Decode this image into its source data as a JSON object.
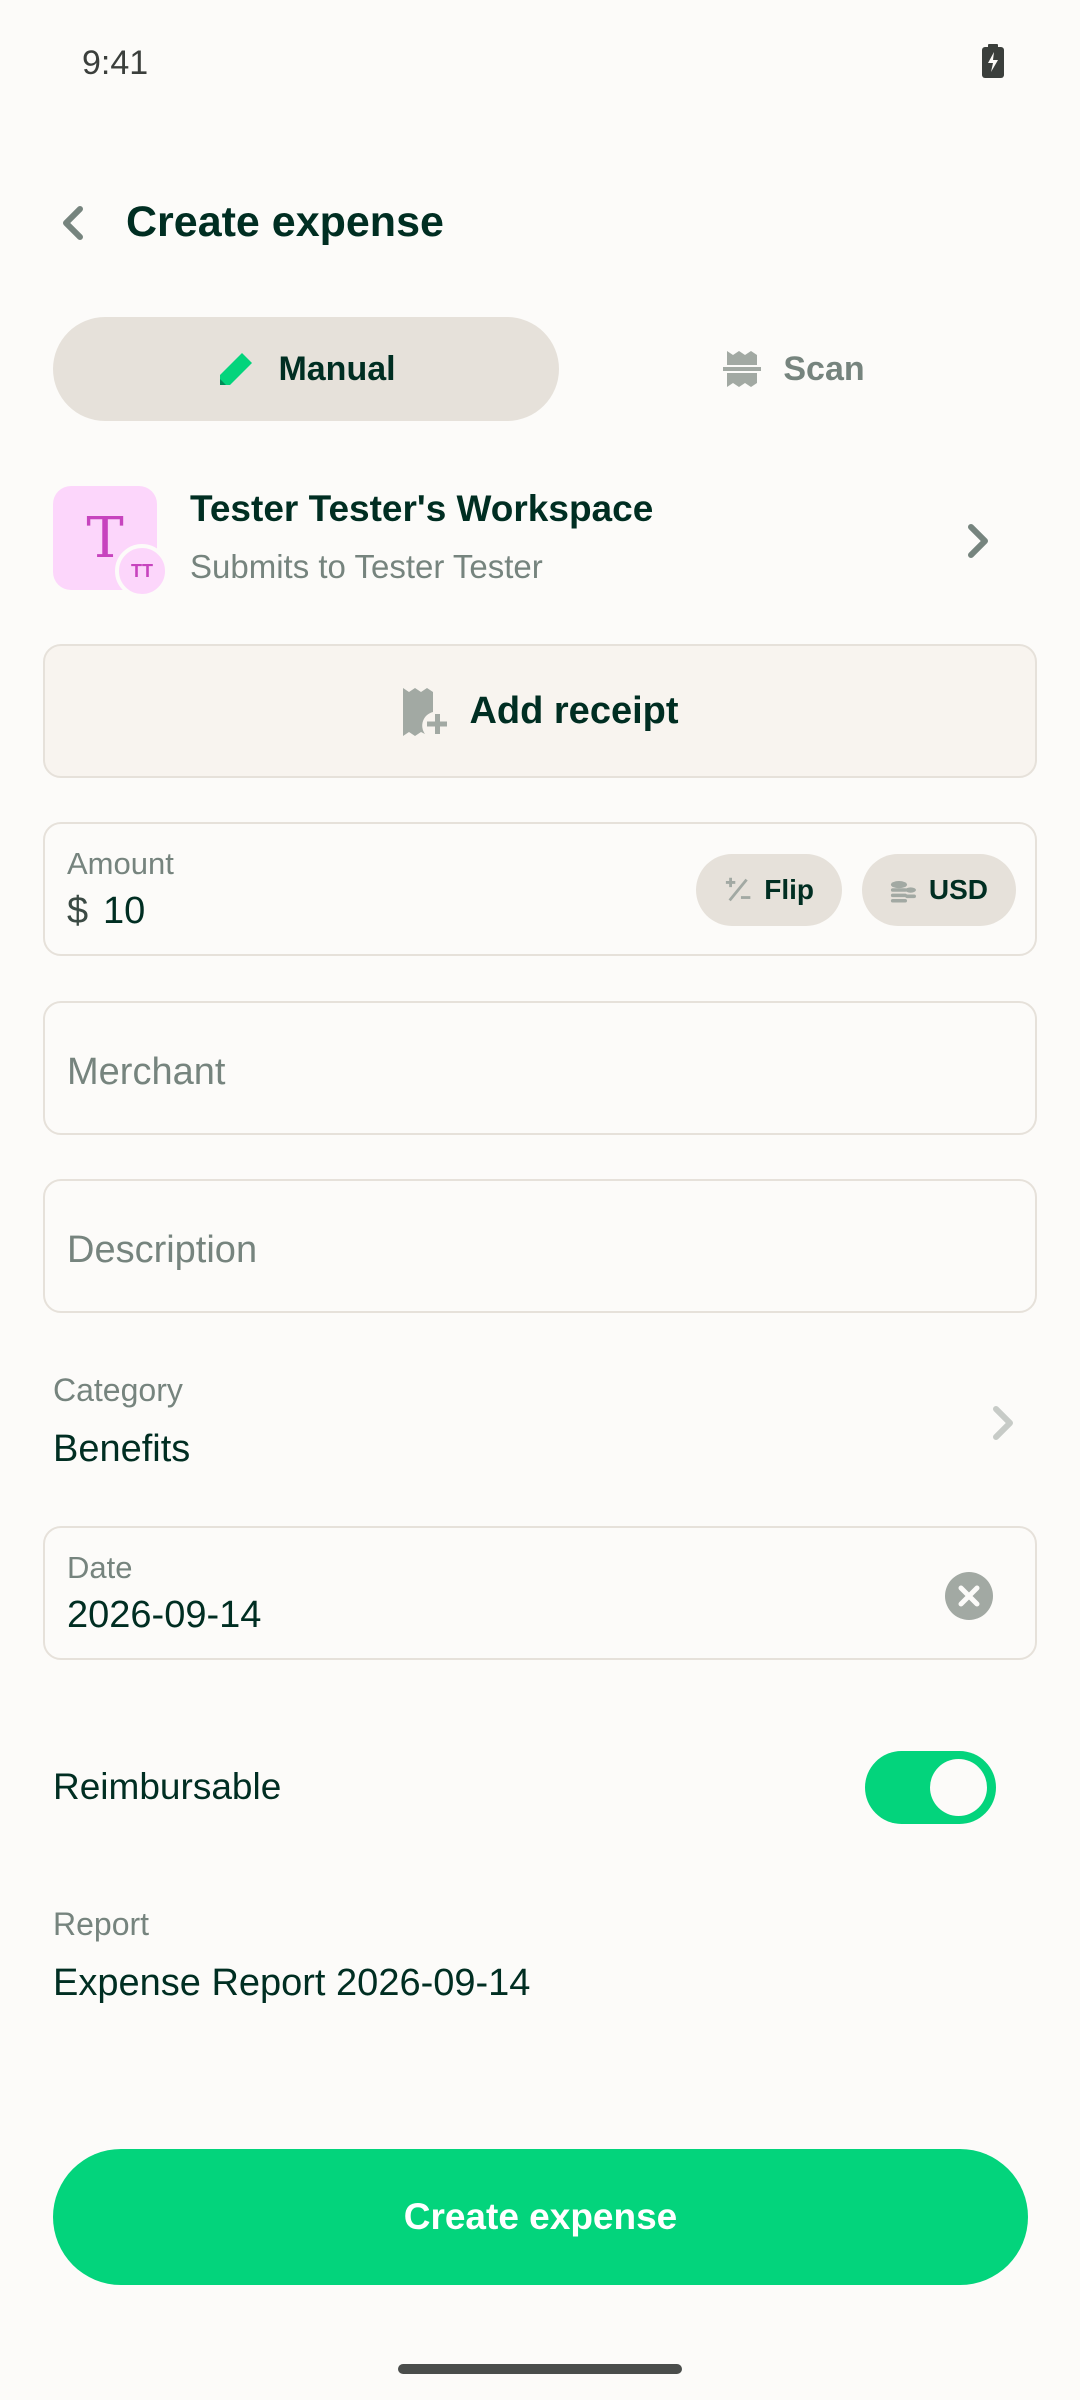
{
  "status_bar": {
    "time": "9:41",
    "battery_icon": "battery-charging-icon"
  },
  "header": {
    "title": "Create expense",
    "back_icon": "chevron-left-icon"
  },
  "tabs": [
    {
      "label": "Manual",
      "icon": "pencil-icon",
      "selected": true
    },
    {
      "label": "Scan",
      "icon": "receipt-scan-icon",
      "selected": false
    }
  ],
  "workspace": {
    "avatar_letter": "T",
    "sub_avatar_initials": "TT",
    "name": "Tester Tester's Workspace",
    "subtitle": "Submits to Tester Tester"
  },
  "add_receipt": {
    "label": "Add receipt",
    "icon": "receipt-plus-icon"
  },
  "amount": {
    "label": "Amount",
    "currency_symbol": "$",
    "value": "10",
    "flip_label": "Flip",
    "currency_label": "USD"
  },
  "merchant": {
    "placeholder": "Merchant"
  },
  "description": {
    "placeholder": "Description"
  },
  "category": {
    "label": "Category",
    "value": "Benefits"
  },
  "date": {
    "label": "Date",
    "value": "2026-09-14"
  },
  "reimbursable": {
    "label": "Reimbursable",
    "enabled": true
  },
  "report": {
    "label": "Report",
    "value": "Expense Report 2026-09-14"
  },
  "submit": {
    "label": "Create expense"
  },
  "colors": {
    "accent": "#03d47c",
    "text": "#002e22",
    "muted": "#76847e",
    "avatar_bg": "#fcd6fb",
    "avatar_fg": "#c744be"
  }
}
